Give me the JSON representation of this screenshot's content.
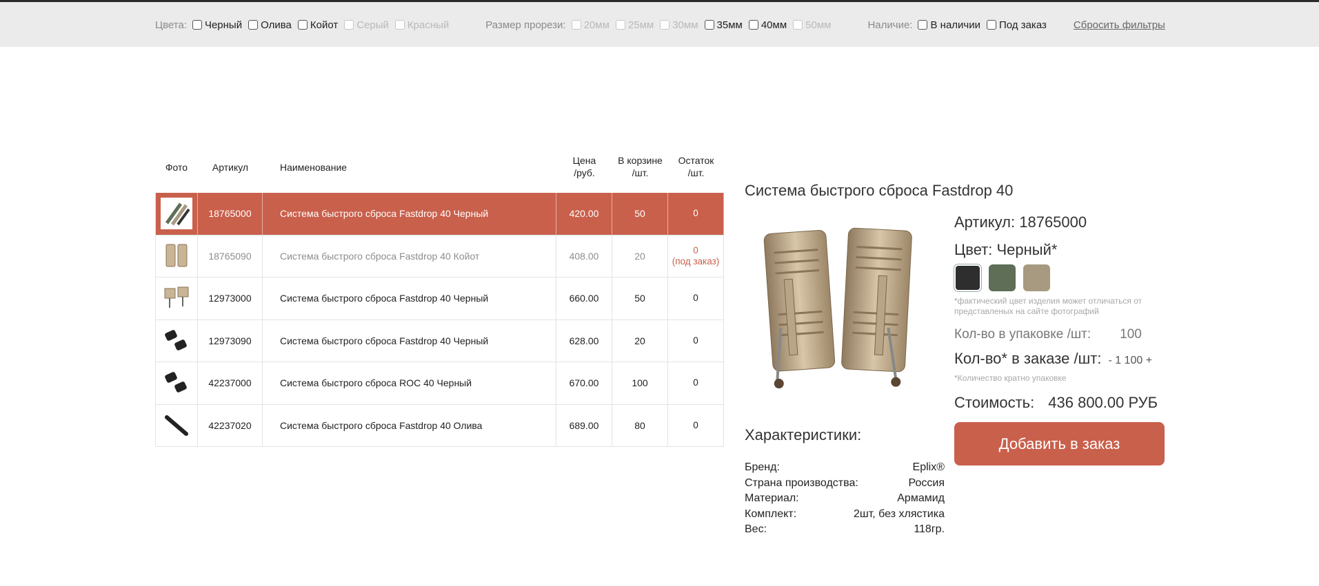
{
  "filters": {
    "colors_label": "Цвета:",
    "colors": [
      {
        "label": "Черный",
        "enabled": true
      },
      {
        "label": "Олива",
        "enabled": true
      },
      {
        "label": "Койот",
        "enabled": true
      },
      {
        "label": "Серый",
        "enabled": false
      },
      {
        "label": "Красный",
        "enabled": false
      }
    ],
    "slot_label": "Размер прорези:",
    "slots": [
      {
        "label": "20мм",
        "enabled": false
      },
      {
        "label": "25мм",
        "enabled": false
      },
      {
        "label": "30мм",
        "enabled": false
      },
      {
        "label": "35мм",
        "enabled": true
      },
      {
        "label": "40мм",
        "enabled": true
      },
      {
        "label": "50мм",
        "enabled": false
      }
    ],
    "availability_label": "Наличие:",
    "availability": [
      {
        "label": "В наличии",
        "enabled": true
      },
      {
        "label": "Под заказ",
        "enabled": true
      }
    ],
    "reset_label": "Сбросить фильтры"
  },
  "table": {
    "headers": {
      "photo": "Фото",
      "sku": "Артикул",
      "name": "Наименование",
      "price_1": "Цена",
      "price_2": "/руб.",
      "cart_1": "В корзине",
      "cart_2": "/шт.",
      "stock_1": "Остаток",
      "stock_2": "/шт."
    },
    "rows": [
      {
        "sku": "18765000",
        "name": "Система быстрого сброса  Fastdrop 40  Черный",
        "price": "420.00",
        "cart": "50",
        "stock": "0",
        "stock_note": "",
        "selected": true,
        "muted": false,
        "thumb": "straps-icon"
      },
      {
        "sku": "18765090",
        "name": "Система быстрого сброса  Fastdrop 40  Койот",
        "price": "408.00",
        "cart": "20",
        "stock": "0",
        "stock_note": "(под заказ)",
        "selected": false,
        "muted": true,
        "thumb": "coyote-fastdrop-icon"
      },
      {
        "sku": "12973000",
        "name": "Система быстрого сброса  Fastdrop 40  Черный",
        "price": "660.00",
        "cart": "50",
        "stock": "0",
        "stock_note": "",
        "selected": false,
        "muted": false,
        "thumb": "tan-tags-icon"
      },
      {
        "sku": "12973090",
        "name": "Система быстрого сброса  Fastdrop 40  Черный",
        "price": "628.00",
        "cart": "20",
        "stock": "0",
        "stock_note": "",
        "selected": false,
        "muted": false,
        "thumb": "black-buckles-icon"
      },
      {
        "sku": "42237000",
        "name": "Система быстрого сброса  ROC 40  Черный",
        "price": "670.00",
        "cart": "100",
        "stock": "0",
        "stock_note": "",
        "selected": false,
        "muted": false,
        "thumb": "black-buckles-icon"
      },
      {
        "sku": "42237020",
        "name": "Система быстрого сброса  Fastdrop 40  Олива",
        "price": "689.00",
        "cart": "80",
        "stock": "0",
        "stock_note": "",
        "selected": false,
        "muted": false,
        "thumb": "strap-icon"
      }
    ]
  },
  "product": {
    "title": "Система быстрого сброса Fastdrop 40",
    "sku_line": "Артикул: 18765000",
    "color_line": "Цвет: Черный*",
    "swatch_colors": [
      "#2e2e2e",
      "#5f6e57",
      "#a89a80"
    ],
    "color_note": "*фактический цвет изделия может отличаться от представленых на сайте фотографий",
    "pack_label": "Кол-во в упаковке /шт:",
    "pack_value": "100",
    "qty_label": "Кол-во* в заказе /шт:",
    "qty_value": "- 1 100 +",
    "qty_note": "*Количество кратно упаковке",
    "cost_label": "Стоимость:",
    "cost_value": "436 800.00 РУБ",
    "add_button": "Добавить в заказ",
    "chars_title": "Характеристики:",
    "chars": [
      {
        "k": "Бренд:",
        "v": "Eplix®"
      },
      {
        "k": "Страна производства:",
        "v": "Россия"
      },
      {
        "k": "Материал:",
        "v": "Армамид"
      },
      {
        "k": "Комплект:",
        "v": "2шт, без хлястика"
      },
      {
        "k": "Вес:",
        "v": "118гр."
      }
    ]
  },
  "colors": {
    "accent": "#c9604c",
    "filterbar": "#ebebeb"
  }
}
